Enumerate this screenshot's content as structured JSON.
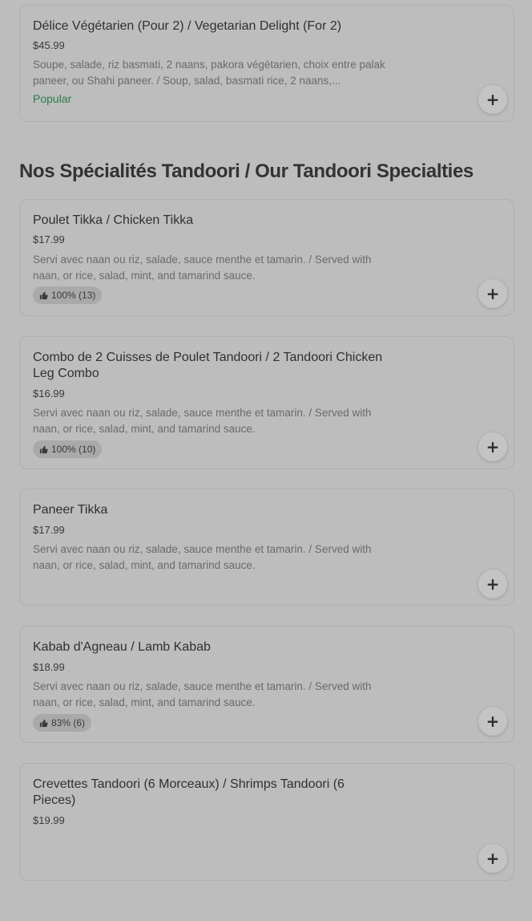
{
  "colors": {
    "page_bg": "#bdbdbd",
    "popular_tag": "#2d7a4a",
    "card_border": "#afafaf"
  },
  "top_item": {
    "name": "Délice Végétarien (Pour 2) / Vegetarian Delight (For 2)",
    "price": "$45.99",
    "description": "Soupe, salade, riz basmati, 2 naans, pakora végétarien, choix entre palak paneer, ou Shahi paneer. / Soup, salad, basmati rice, 2 naans,...",
    "tag": "Popular",
    "add_icon": "plus-icon"
  },
  "section": {
    "title": "Nos Spécialités Tandoori / Our Tandoori Specialties"
  },
  "items": [
    {
      "name": "Poulet Tikka / Chicken Tikka",
      "price": "$17.99",
      "description": "Servi avec naan ou riz, salade, sauce menthe et tamarin. / Served with naan, or rice, salad, mint, and tamarind sauce.",
      "rating": "100% (13)"
    },
    {
      "name": "Combo de 2 Cuisses de Poulet Tandoori / 2 Tandoori Chicken Leg Combo",
      "price": "$16.99",
      "description": "Servi avec naan ou riz, salade, sauce menthe et tamarin. / Served with naan, or rice, salad, mint, and tamarind sauce.",
      "rating": "100% (10)"
    },
    {
      "name": "Paneer Tikka",
      "price": "$17.99",
      "description": "Servi avec naan ou riz, salade, sauce menthe et tamarin. / Served with naan, or rice, salad, mint, and tamarind sauce."
    },
    {
      "name": "Kabab d'Agneau / Lamb Kabab",
      "price": "$18.99",
      "description": "Servi avec naan ou riz, salade, sauce menthe et tamarin. / Served with naan, or rice, salad, mint, and tamarind sauce.",
      "rating": "83% (6)"
    },
    {
      "name": "Crevettes Tandoori (6 Morceaux) / Shrimps Tandoori (6 Pieces)",
      "price": "$19.99"
    }
  ],
  "icons": {
    "add": "plus-icon",
    "rating": "thumbs-up-icon"
  },
  "add_symbol": "+"
}
